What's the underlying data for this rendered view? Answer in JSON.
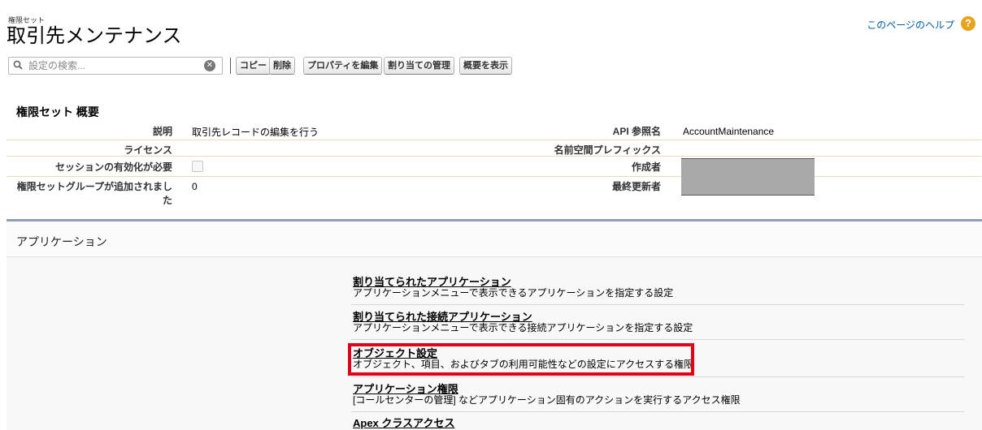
{
  "header": {
    "eyebrow": "権限セット",
    "title": "取引先メンテナンス",
    "help_link": "このページのヘルプ",
    "help_icon": "question-icon"
  },
  "toolbar": {
    "search_placeholder": "設定の検索...",
    "buttons": [
      "コピー",
      "削除",
      "プロパティを編集",
      "割り当ての管理",
      "概要を表示"
    ]
  },
  "overview": {
    "title": "権限セット 概要",
    "left": [
      {
        "label": "説明",
        "value": "取引先レコードの編集を行う"
      },
      {
        "label": "ライセンス",
        "value": ""
      },
      {
        "label": "セッションの有効化が必要",
        "value": ""
      },
      {
        "label": "権限セットグループが追加されました",
        "value": "0"
      }
    ],
    "right": [
      {
        "label": "API 参照名",
        "value": "AccountMaintenance"
      },
      {
        "label": "名前空間プレフィックス",
        "value": ""
      },
      {
        "label": "作成者",
        "value": ""
      },
      {
        "label": "最終更新者",
        "value": ""
      }
    ]
  },
  "apps": {
    "title": "アプリケーション",
    "items": [
      {
        "title": "割り当てられたアプリケーション",
        "desc": "アプリケーションメニューで表示できるアプリケーションを指定する設定"
      },
      {
        "title": "割り当てられた接続アプリケーション",
        "desc": "アプリケーションメニューで表示できる接続アプリケーションを指定する設定"
      },
      {
        "title": "オブジェクト設定",
        "desc": "オブジェクト、項目、およびタブの利用可能性などの設定にアクセスする権限"
      },
      {
        "title": "アプリケーション権限",
        "desc": "[コールセンターの管理] などアプリケーション固有のアクションを実行するアクセス権限"
      },
      {
        "title": "Apex クラスアクセス",
        "desc": ""
      }
    ]
  },
  "colors": {
    "highlight": "#e0001a",
    "link": "#015ba7",
    "panel_border": "#8e9dbe"
  }
}
